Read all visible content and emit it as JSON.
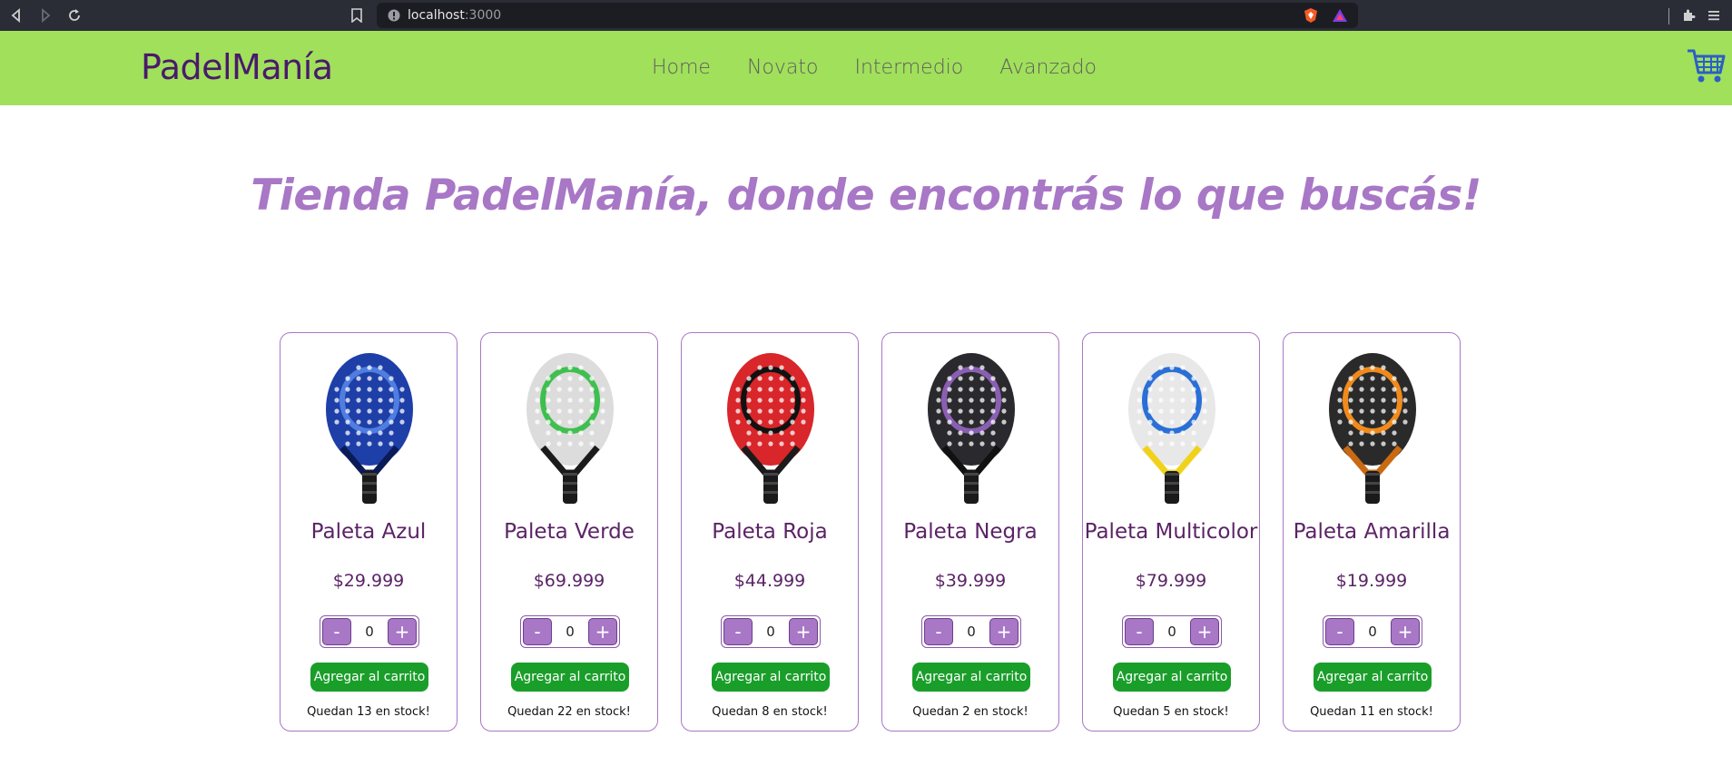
{
  "browser": {
    "url_host": "localhost",
    "url_port": ":3000"
  },
  "header": {
    "brand": "PadelManía",
    "nav": [
      {
        "label": "Home"
      },
      {
        "label": "Novato"
      },
      {
        "label": "Intermedio"
      },
      {
        "label": "Avanzado"
      }
    ]
  },
  "hero": {
    "title": "Tienda PadelManía, donde encontrás lo que buscás!"
  },
  "controls": {
    "minus": "-",
    "plus": "+",
    "add_to_cart": "Agregar al carrito"
  },
  "products": [
    {
      "name": "Paleta Azul",
      "price": "$29.999",
      "qty": "0",
      "stock": "Quedan 13 en stock!",
      "colors": {
        "face": "#1e3fa8",
        "accent": "#4f7de0",
        "frame": "#0b1b55"
      }
    },
    {
      "name": "Paleta Verde",
      "price": "$69.999",
      "qty": "0",
      "stock": "Quedan 22 en stock!",
      "colors": {
        "face": "#dcdcdc",
        "accent": "#3fbf4f",
        "frame": "#1b1b1b"
      }
    },
    {
      "name": "Paleta Roja",
      "price": "$44.999",
      "qty": "0",
      "stock": "Quedan 8 en stock!",
      "colors": {
        "face": "#d8262a",
        "accent": "#111111",
        "frame": "#1b1b1b"
      }
    },
    {
      "name": "Paleta Negra",
      "price": "$39.999",
      "qty": "0",
      "stock": "Quedan 2 en stock!",
      "colors": {
        "face": "#2a2a2e",
        "accent": "#8a5fb3",
        "frame": "#111111"
      }
    },
    {
      "name": "Paleta Multicolor",
      "price": "$79.999",
      "qty": "0",
      "stock": "Quedan 5 en stock!",
      "colors": {
        "face": "#e8e8e8",
        "accent": "#2a6fd6",
        "frame": "#f1d21a"
      }
    },
    {
      "name": "Paleta Amarilla",
      "price": "$19.999",
      "qty": "0",
      "stock": "Quedan 11 en stock!",
      "colors": {
        "face": "#2a2a2a",
        "accent": "#f08a1c",
        "frame": "#c96a12"
      }
    }
  ]
}
